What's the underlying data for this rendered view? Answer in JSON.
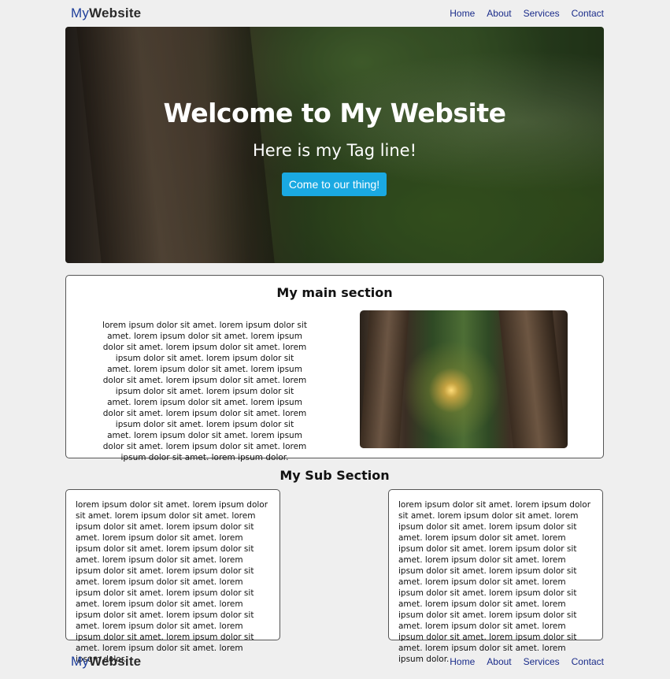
{
  "nav": {
    "logo_my": "My",
    "logo_site": "Website",
    "links": [
      "Home",
      "About",
      "Services",
      "Contact"
    ]
  },
  "hero": {
    "title": "Welcome to My Website",
    "tagline": "Here is my Tag line!",
    "button_label": "Come to our thing!"
  },
  "main_section": {
    "heading": "My main section",
    "text": "lorem ipsum dolor sit amet. lorem ipsum dolor sit amet. lorem ipsum dolor sit amet. lorem ipsum dolor sit amet. lorem ipsum dolor sit amet. lorem ipsum dolor sit amet. lorem ipsum dolor sit amet. lorem ipsum dolor sit amet. lorem ipsum dolor sit amet. lorem ipsum dolor sit amet. lorem ipsum dolor sit amet. lorem ipsum dolor sit amet. lorem ipsum dolor sit amet. lorem ipsum dolor sit amet. lorem ipsum dolor sit amet. lorem ipsum dolor sit amet. lorem ipsum dolor sit amet. lorem ipsum dolor sit amet. lorem ipsum dolor sit amet. lorem ipsum dolor sit amet. lorem ipsum dolor sit amet. lorem ipsum dolor."
  },
  "sub_section": {
    "heading": "My Sub Section",
    "cards": [
      {
        "text": "lorem ipsum dolor sit amet. lorem ipsum dolor sit amet. lorem ipsum dolor sit amet. lorem ipsum dolor sit amet. lorem ipsum dolor sit amet. lorem ipsum dolor sit amet. lorem ipsum dolor sit amet. lorem ipsum dolor sit amet. lorem ipsum dolor sit amet. lorem ipsum dolor sit amet. lorem ipsum dolor sit amet. lorem ipsum dolor sit amet. lorem ipsum dolor sit amet. lorem ipsum dolor sit amet. lorem ipsum dolor sit amet. lorem ipsum dolor sit amet. lorem ipsum dolor sit amet. lorem ipsum dolor sit amet. lorem ipsum dolor sit amet. lorem ipsum dolor sit amet. lorem ipsum dolor sit amet. lorem ipsum dolor."
      },
      {
        "text": "lorem ipsum dolor sit amet. lorem ipsum dolor sit amet. lorem ipsum dolor sit amet. lorem ipsum dolor sit amet. lorem ipsum dolor sit amet. lorem ipsum dolor sit amet. lorem ipsum dolor sit amet. lorem ipsum dolor sit amet. lorem ipsum dolor sit amet. lorem ipsum dolor sit amet. lorem ipsum dolor sit amet. lorem ipsum dolor sit amet. lorem ipsum dolor sit amet. lorem ipsum dolor sit amet. lorem ipsum dolor sit amet. lorem ipsum dolor sit amet. lorem ipsum dolor sit amet. lorem ipsum dolor sit amet. lorem ipsum dolor sit amet. lorem ipsum dolor sit amet. lorem ipsum dolor sit amet. lorem ipsum dolor."
      }
    ]
  },
  "footer": {
    "logo_my": "My",
    "logo_site": "Website",
    "links": [
      "Home",
      "About",
      "Services",
      "Contact"
    ]
  },
  "colors": {
    "page_bg": "#efefef",
    "logo_my": "#1f3f9a",
    "nav_link": "#1a2c8a",
    "button_bg": "#1aa9e2"
  }
}
